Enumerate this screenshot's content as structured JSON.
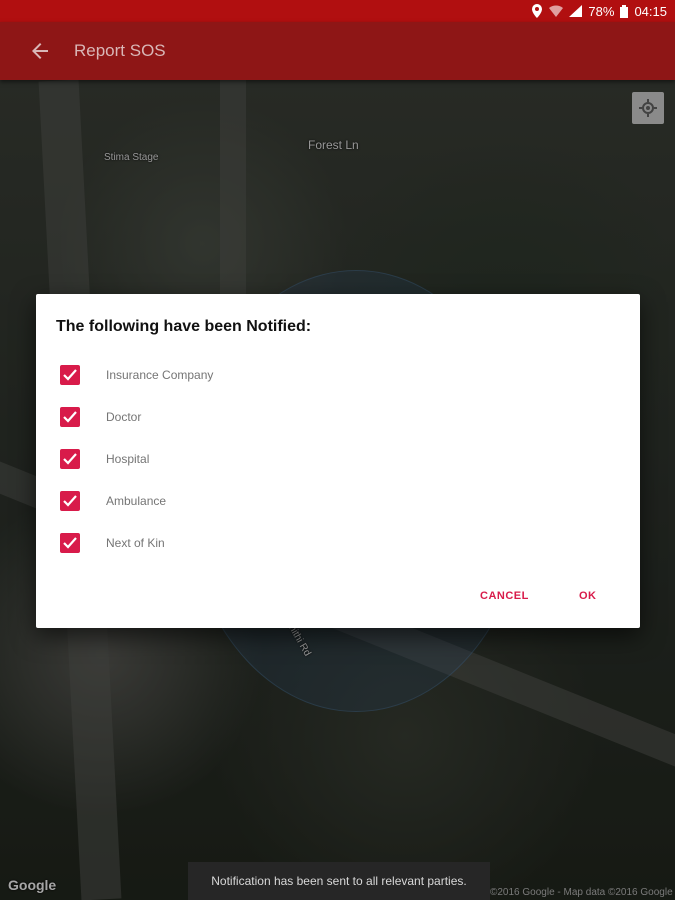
{
  "status_bar": {
    "battery": "78%",
    "time": "04:15"
  },
  "app_bar": {
    "title": "Report SOS",
    "back_icon": "arrow-left-icon"
  },
  "map": {
    "labels": [
      "Forest Ln",
      "Stima Stage",
      "Muthithi Rd"
    ],
    "google": "Google",
    "attribution": "©2016 Google - Map data ©2016 Google"
  },
  "dialog": {
    "title": "The following have been Notified:",
    "items": [
      {
        "label": "Insurance Company",
        "checked": true
      },
      {
        "label": "Doctor",
        "checked": true
      },
      {
        "label": "Hospital",
        "checked": true
      },
      {
        "label": "Ambulance",
        "checked": true
      },
      {
        "label": "Next of Kin",
        "checked": true
      }
    ],
    "cancel_label": "CANCEL",
    "ok_label": "OK"
  },
  "snackbar": {
    "message": "Notification has been sent to all relevant parties."
  },
  "colors": {
    "status_bar": "#b10f10",
    "app_bar": "#8e1616",
    "accent": "#d81b4a"
  }
}
